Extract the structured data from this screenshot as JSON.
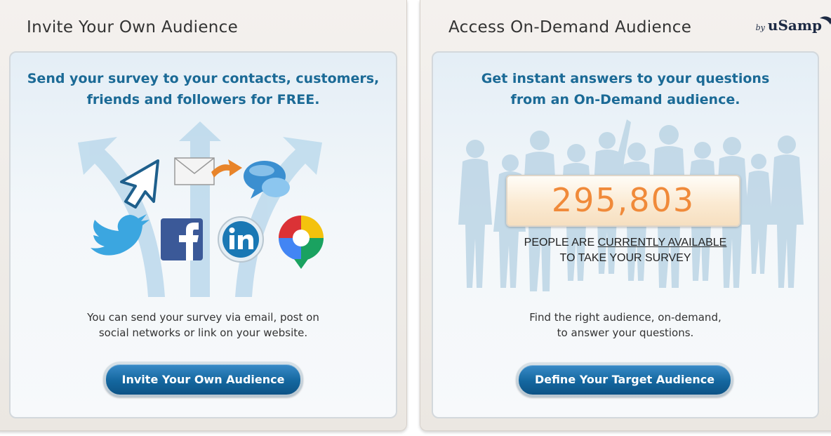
{
  "left_panel": {
    "title": "Invite Your Own Audience",
    "headline": [
      "Send your survey to your contacts, customers,",
      "friends and followers for FREE."
    ],
    "description": [
      "You can send your survey via email, post on",
      "social networks or link on your website."
    ],
    "button_label": "Invite Your Own Audience",
    "icons": [
      "cursor-icon",
      "email-icon",
      "chat-bubble-icon",
      "twitter-icon",
      "facebook-icon",
      "linkedin-icon",
      "google-buzz-icon"
    ]
  },
  "right_panel": {
    "title": "Access On-Demand Audience",
    "brand_by": "by",
    "brand_name": "uSamp",
    "headline": [
      "Get instant answers to your questions",
      "from an On-Demand audience."
    ],
    "counter_value": "295,803",
    "counter_caption_pre": "PEOPLE ARE ",
    "counter_caption_highlight": "CURRENTLY AVAILABLE",
    "counter_caption_line2": "TO TAKE YOUR SURVEY",
    "description": [
      "Find the right audience, on-demand,",
      "to answer your questions."
    ],
    "button_label": "Define Your Target Audience"
  },
  "colors": {
    "headline": "#1b6a96",
    "counter": "#f08a3a",
    "button": "#14679f"
  }
}
